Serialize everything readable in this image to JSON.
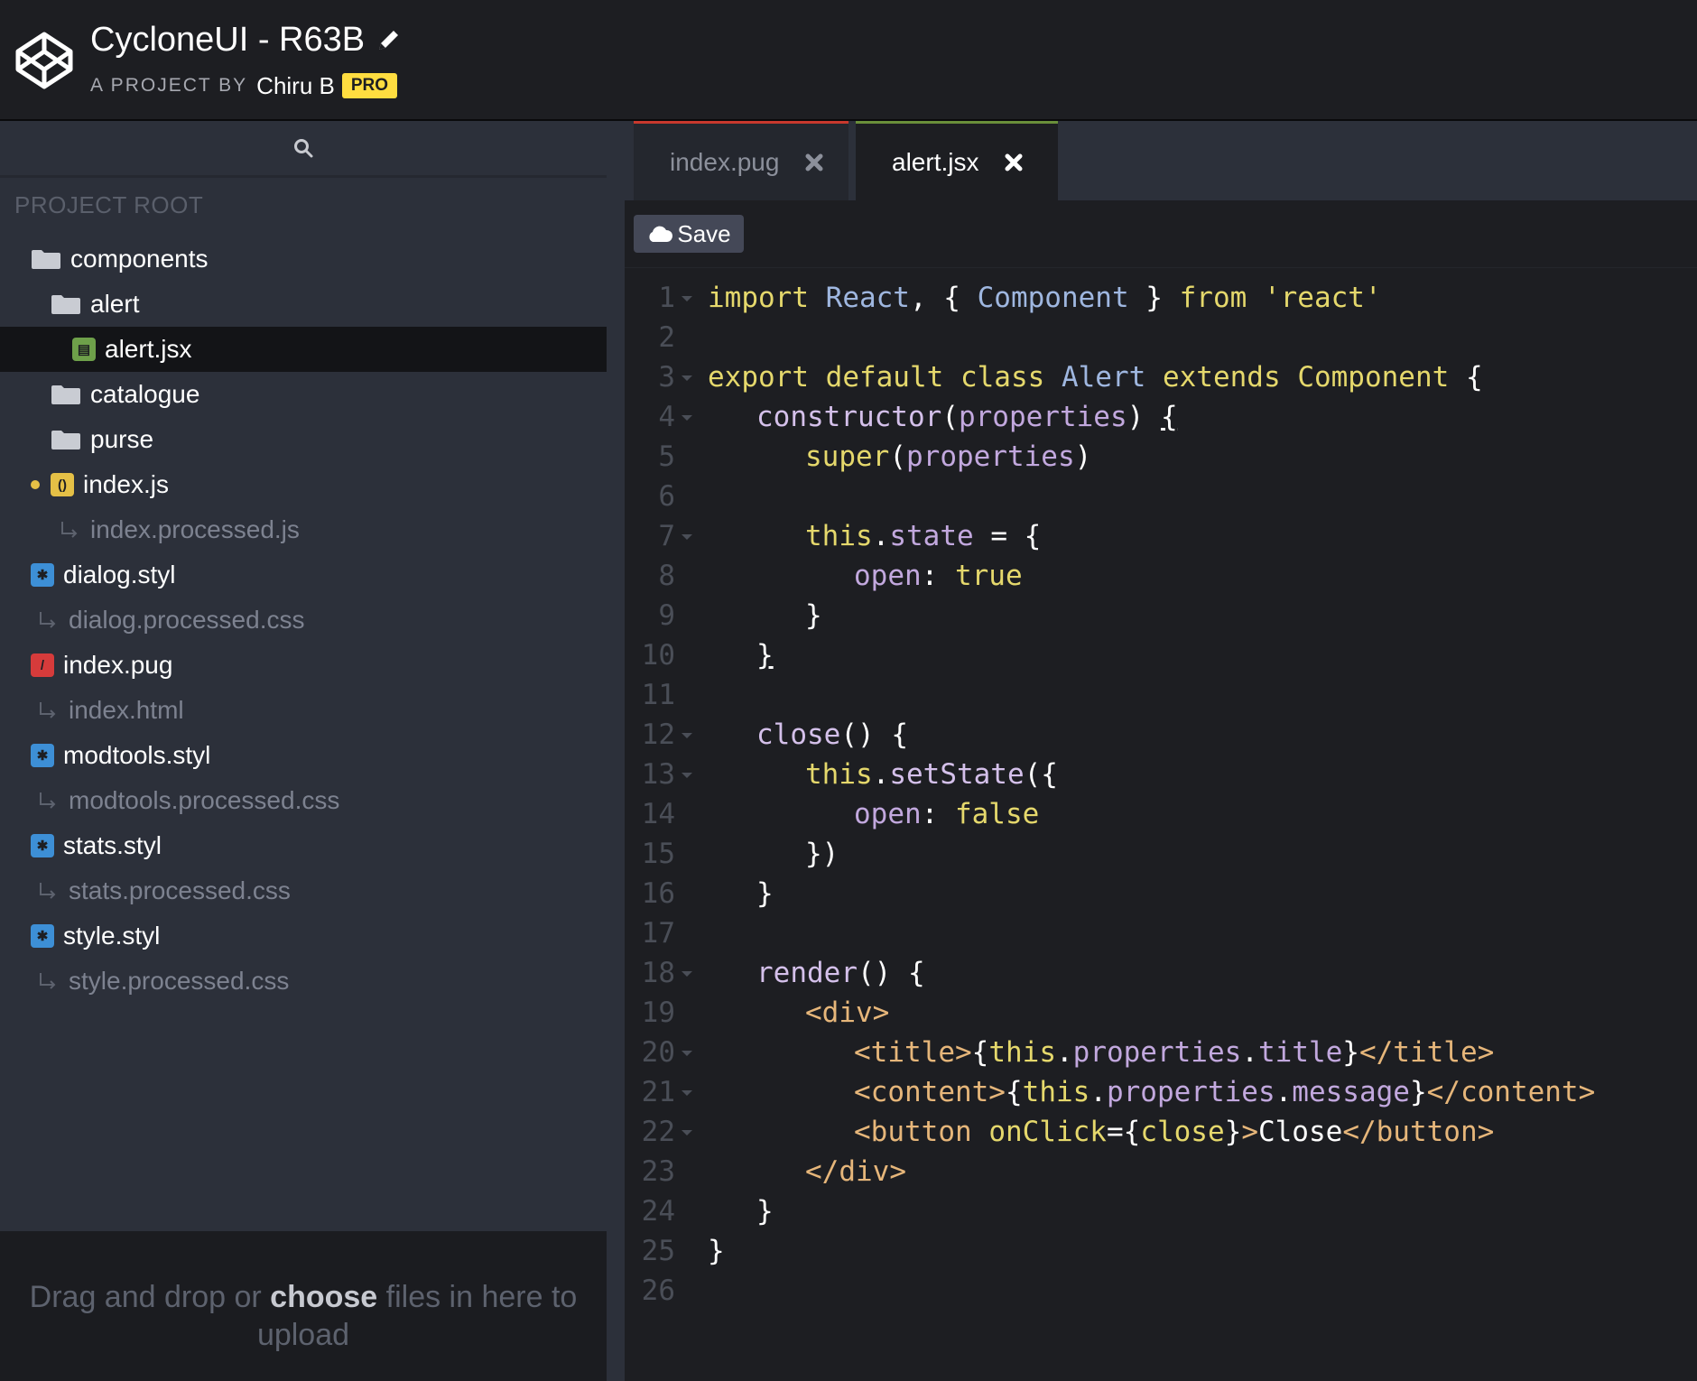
{
  "header": {
    "title": "CycloneUI - R63B",
    "byline": "A PROJECT BY",
    "author": "Chiru B",
    "badge": "PRO"
  },
  "sidebar": {
    "section_label": "PROJECT ROOT",
    "items": [
      {
        "label": "components",
        "type": "folder",
        "indent": 0
      },
      {
        "label": "alert",
        "type": "folder",
        "indent": 1
      },
      {
        "label": "alert.jsx",
        "type": "jsx",
        "indent": 2,
        "selected": true
      },
      {
        "label": "catalogue",
        "type": "folder",
        "indent": 1
      },
      {
        "label": "purse",
        "type": "folder",
        "indent": 1
      },
      {
        "label": "index.js",
        "type": "js",
        "indent": 1,
        "modified": true
      },
      {
        "label": "index.processed.js",
        "type": "processed",
        "indent": 1
      },
      {
        "label": "dialog.styl",
        "type": "styl",
        "indent": 0
      },
      {
        "label": "dialog.processed.css",
        "type": "processed",
        "indent": 0
      },
      {
        "label": "index.pug",
        "type": "pug",
        "indent": 0
      },
      {
        "label": "index.html",
        "type": "processed",
        "indent": 0
      },
      {
        "label": "modtools.styl",
        "type": "styl",
        "indent": 0
      },
      {
        "label": "modtools.processed.css",
        "type": "processed",
        "indent": 0
      },
      {
        "label": "stats.styl",
        "type": "styl",
        "indent": 0
      },
      {
        "label": "stats.processed.css",
        "type": "processed",
        "indent": 0
      },
      {
        "label": "style.styl",
        "type": "styl",
        "indent": 0
      },
      {
        "label": "style.processed.css",
        "type": "processed",
        "indent": 0
      }
    ],
    "dropzone": {
      "text_before": "Drag and drop or ",
      "choose": "choose",
      "text_after": " files in here to upload"
    }
  },
  "editor": {
    "tabs": [
      {
        "label": "index.pug",
        "active": false
      },
      {
        "label": "alert.jsx",
        "active": true
      }
    ],
    "save_label": "Save",
    "lines": [
      {
        "n": "1",
        "fold": true,
        "indent": 0,
        "tokens": [
          [
            "kw",
            "import"
          ],
          [
            "pl",
            " "
          ],
          [
            "cls",
            "React"
          ],
          [
            "pl",
            ", { "
          ],
          [
            "cls",
            "Component"
          ],
          [
            "pl",
            " } "
          ],
          [
            "kw",
            "from"
          ],
          [
            "pl",
            " "
          ],
          [
            "str",
            "'react'"
          ]
        ]
      },
      {
        "n": "2",
        "fold": false,
        "indent": 0,
        "tokens": []
      },
      {
        "n": "3",
        "fold": true,
        "indent": 0,
        "tokens": [
          [
            "kw",
            "export"
          ],
          [
            "pl",
            " "
          ],
          [
            "kw",
            "default"
          ],
          [
            "pl",
            " "
          ],
          [
            "kw",
            "class"
          ],
          [
            "pl",
            " "
          ],
          [
            "cls",
            "Alert"
          ],
          [
            "pl",
            " "
          ],
          [
            "kw",
            "extends"
          ],
          [
            "pl",
            " "
          ],
          [
            "kw",
            "Component"
          ],
          [
            "pl",
            " {"
          ]
        ]
      },
      {
        "n": "4",
        "fold": true,
        "indent": 1,
        "tokens": [
          [
            "fn",
            "constructor"
          ],
          [
            "pl",
            "("
          ],
          [
            "prop",
            "properties"
          ],
          [
            "pl",
            ") "
          ],
          [
            "ul",
            "{"
          ]
        ]
      },
      {
        "n": "5",
        "fold": false,
        "indent": 2,
        "tokens": [
          [
            "kw",
            "super"
          ],
          [
            "pl",
            "("
          ],
          [
            "prop",
            "properties"
          ],
          [
            "pl",
            ")"
          ]
        ]
      },
      {
        "n": "6",
        "fold": false,
        "indent": 0,
        "tokens": []
      },
      {
        "n": "7",
        "fold": true,
        "indent": 2,
        "tokens": [
          [
            "kw",
            "this"
          ],
          [
            "pl",
            "."
          ],
          [
            "prop",
            "state"
          ],
          [
            "pl",
            " = {"
          ]
        ]
      },
      {
        "n": "8",
        "fold": false,
        "indent": 3,
        "tokens": [
          [
            "prop",
            "open"
          ],
          [
            "pl",
            ": "
          ],
          [
            "kw",
            "true"
          ]
        ]
      },
      {
        "n": "9",
        "fold": false,
        "indent": 2,
        "tokens": [
          [
            "pl",
            "}"
          ]
        ]
      },
      {
        "n": "10",
        "fold": false,
        "indent": 1,
        "tokens": [
          [
            "ul",
            "}"
          ]
        ]
      },
      {
        "n": "11",
        "fold": false,
        "indent": 0,
        "tokens": []
      },
      {
        "n": "12",
        "fold": true,
        "indent": 1,
        "tokens": [
          [
            "fn",
            "close"
          ],
          [
            "pl",
            "() {"
          ]
        ]
      },
      {
        "n": "13",
        "fold": true,
        "indent": 2,
        "tokens": [
          [
            "kw",
            "this"
          ],
          [
            "pl",
            "."
          ],
          [
            "fn",
            "setState"
          ],
          [
            "pl",
            "({"
          ]
        ]
      },
      {
        "n": "14",
        "fold": false,
        "indent": 3,
        "tokens": [
          [
            "prop",
            "open"
          ],
          [
            "pl",
            ": "
          ],
          [
            "kw",
            "false"
          ]
        ]
      },
      {
        "n": "15",
        "fold": false,
        "indent": 2,
        "tokens": [
          [
            "pl",
            "})"
          ]
        ]
      },
      {
        "n": "16",
        "fold": false,
        "indent": 1,
        "tokens": [
          [
            "pl",
            "}"
          ]
        ]
      },
      {
        "n": "17",
        "fold": false,
        "indent": 0,
        "tokens": []
      },
      {
        "n": "18",
        "fold": true,
        "indent": 1,
        "tokens": [
          [
            "fn",
            "render"
          ],
          [
            "pl",
            "() {"
          ]
        ]
      },
      {
        "n": "19",
        "fold": false,
        "indent": 2,
        "tokens": [
          [
            "tag",
            "<div>"
          ]
        ]
      },
      {
        "n": "20",
        "fold": true,
        "indent": 3,
        "tokens": [
          [
            "tag",
            "<title>"
          ],
          [
            "pl",
            "{"
          ],
          [
            "kw",
            "this"
          ],
          [
            "pl",
            "."
          ],
          [
            "prop",
            "properties"
          ],
          [
            "pl",
            "."
          ],
          [
            "prop",
            "title"
          ],
          [
            "pl",
            "}"
          ],
          [
            "tag",
            "</title>"
          ]
        ]
      },
      {
        "n": "21",
        "fold": true,
        "indent": 3,
        "tokens": [
          [
            "tag",
            "<content>"
          ],
          [
            "pl",
            "{"
          ],
          [
            "kw",
            "this"
          ],
          [
            "pl",
            "."
          ],
          [
            "prop",
            "properties"
          ],
          [
            "pl",
            "."
          ],
          [
            "prop",
            "message"
          ],
          [
            "pl",
            "}"
          ],
          [
            "tag",
            "</content>"
          ]
        ]
      },
      {
        "n": "22",
        "fold": true,
        "indent": 3,
        "tokens": [
          [
            "tag",
            "<button"
          ],
          [
            "pl",
            " "
          ],
          [
            "kw",
            "onClick"
          ],
          [
            "pl",
            "={"
          ],
          [
            "kw",
            "close"
          ],
          [
            "pl",
            "}"
          ],
          [
            "tag",
            ">"
          ],
          [
            "pl",
            "Close"
          ],
          [
            "tag",
            "</button>"
          ]
        ]
      },
      {
        "n": "23",
        "fold": false,
        "indent": 2,
        "tokens": [
          [
            "tag",
            "</div>"
          ]
        ]
      },
      {
        "n": "24",
        "fold": false,
        "indent": 1,
        "tokens": [
          [
            "pl",
            "}"
          ]
        ]
      },
      {
        "n": "25",
        "fold": false,
        "indent": 0,
        "tokens": [
          [
            "pl",
            "}"
          ]
        ]
      },
      {
        "n": "26",
        "fold": false,
        "indent": 0,
        "tokens": []
      }
    ]
  },
  "colors": {
    "background": "#1d1e22",
    "sidebar": "#2c303a",
    "pro_badge": "#ffdd40",
    "keyword": "#e5d86c",
    "class_name": "#9fb7e0",
    "property": "#c2a8de",
    "tag": "#e6b67a"
  },
  "icons": [
    "codepen-logo-icon",
    "pencil-icon",
    "search-icon",
    "folder-icon",
    "jsx-file-icon",
    "js-file-icon",
    "styl-file-icon",
    "pug-file-icon",
    "processed-arrow-icon",
    "close-icon",
    "cloud-icon",
    "fold-arrow-icon"
  ]
}
